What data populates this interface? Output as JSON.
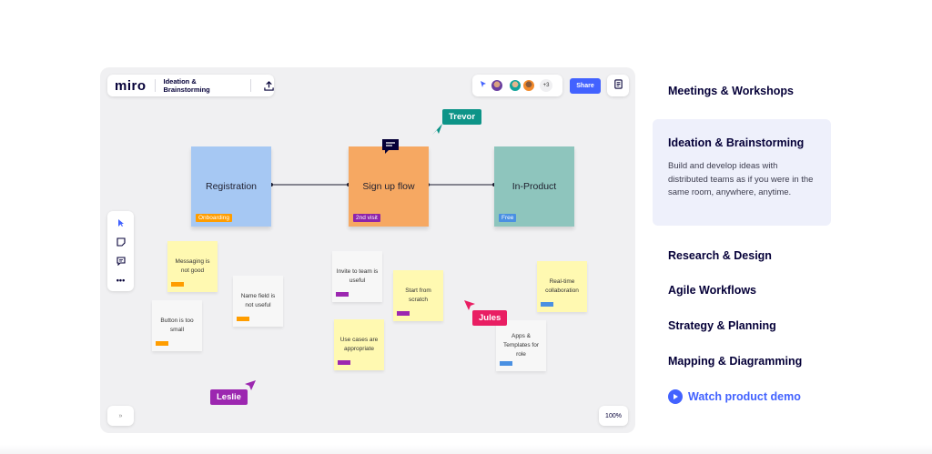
{
  "board": {
    "logo": "miro",
    "title": "Ideation & Brainstorming",
    "share_label": "Share",
    "extra_collaborators": "+3",
    "zoom": "100%",
    "expand_label": "»",
    "frames": [
      {
        "label": "Registration",
        "tag": "Onboarding",
        "color": "#a6c8f3",
        "tag_color": "#ff9d00"
      },
      {
        "label": "Sign up flow",
        "tag": "2nd visit",
        "color": "#f6a862",
        "tag_color": "#8e24aa"
      },
      {
        "label": "In-Product",
        "tag": "Free",
        "color": "#8ec5bd",
        "tag_color": "#4a90e2"
      }
    ],
    "stickies": [
      {
        "text": "Messaging is not good"
      },
      {
        "text": "Name field is not useful"
      },
      {
        "text": "Button is too small"
      },
      {
        "text": "Invite to team is useful"
      },
      {
        "text": "Start from scratch"
      },
      {
        "text": "Use cases are appropriate"
      },
      {
        "text": "Real-time collaboration"
      },
      {
        "text": "Apps & Templates for role"
      }
    ],
    "cursors": [
      {
        "name": "Trevor",
        "color": "#0d9488"
      },
      {
        "name": "Jules",
        "color": "#e91e63"
      },
      {
        "name": "Leslie",
        "color": "#9c27b0"
      }
    ]
  },
  "menu": {
    "items": [
      {
        "label": "Meetings & Workshops"
      },
      {
        "label": "Research & Design"
      },
      {
        "label": "Agile Workflows"
      },
      {
        "label": "Strategy & Planning"
      },
      {
        "label": "Mapping & Diagramming"
      }
    ],
    "active": {
      "title": "Ideation & Brainstorming",
      "description": "Build and develop ideas with distributed teams as if you were in the same room, anywhere, anytime."
    },
    "demo_label": "Watch product demo"
  }
}
